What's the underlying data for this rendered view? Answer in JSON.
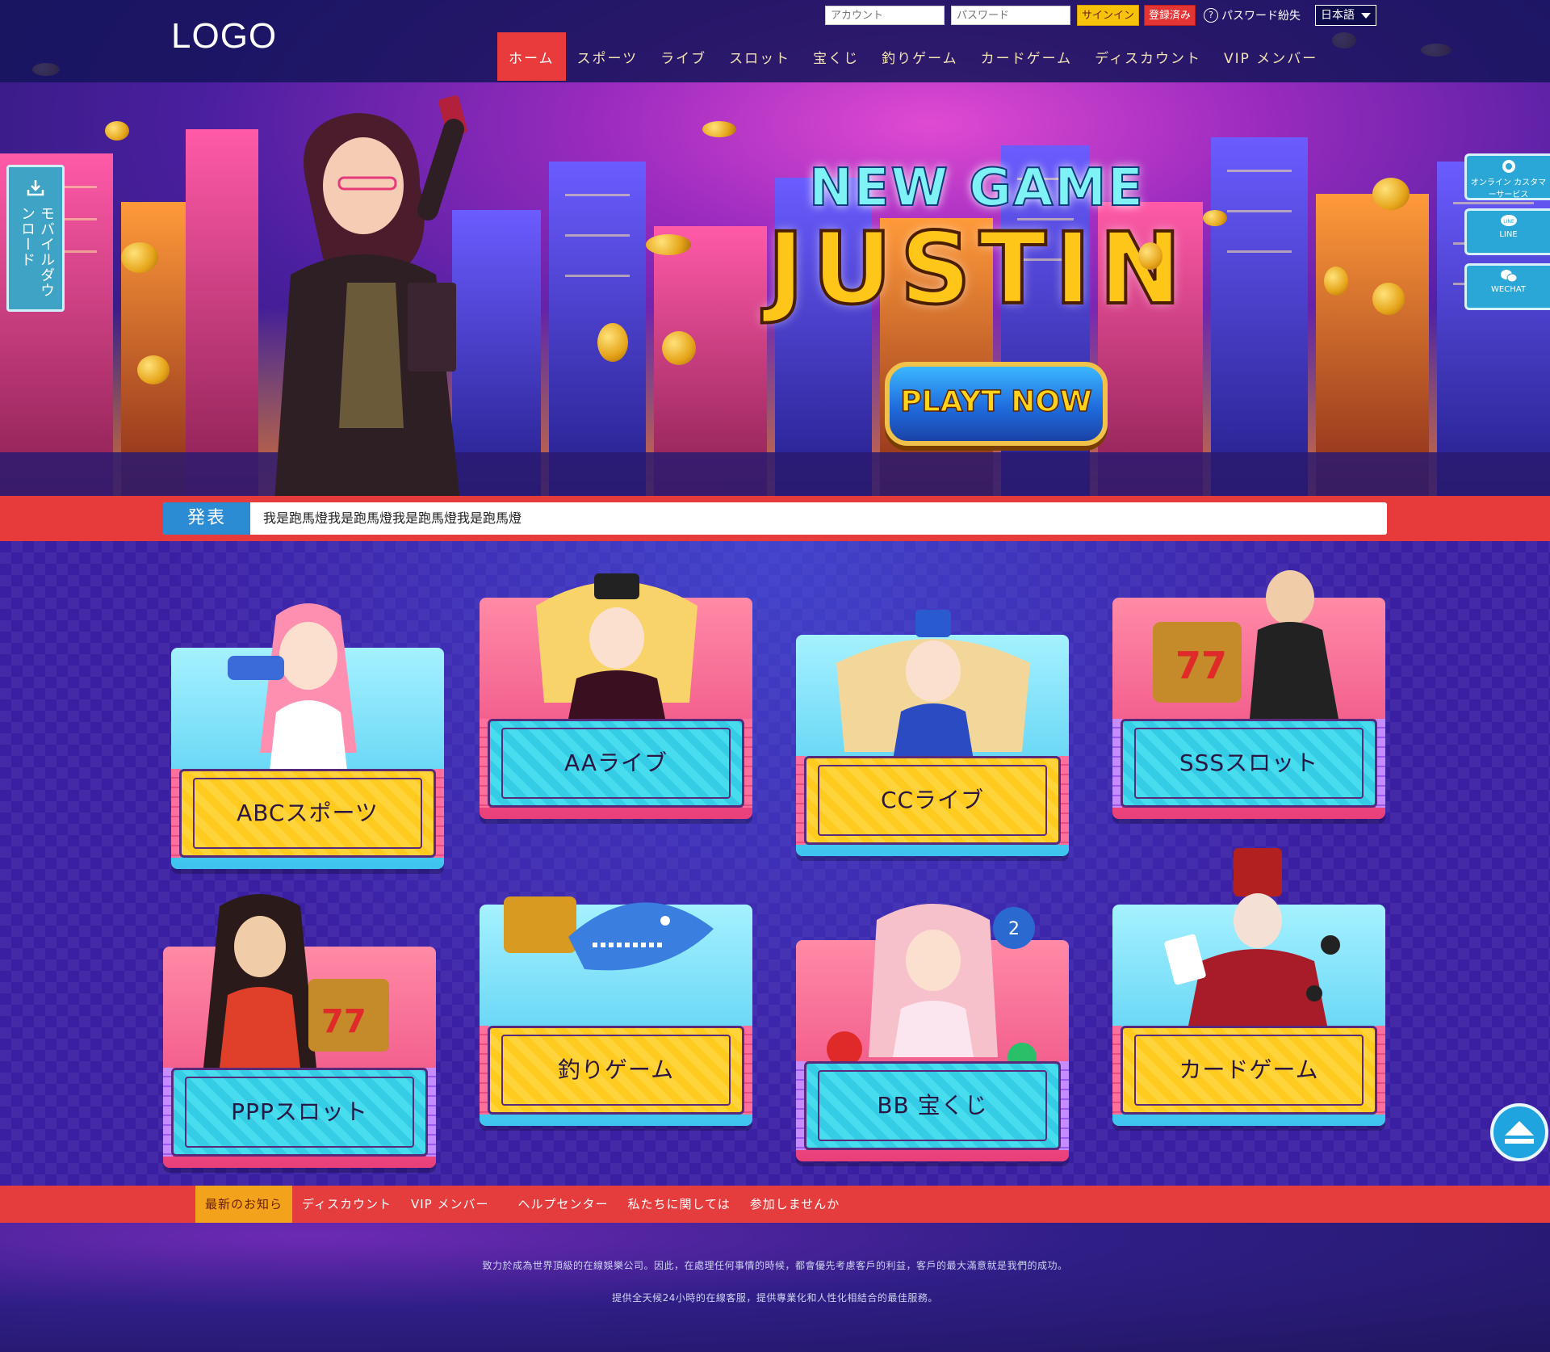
{
  "header": {
    "logo": "LOGO",
    "account_placeholder": "アカウント",
    "password_placeholder": "パスワード",
    "signin_label": "サインイン",
    "register_label": "登録済み",
    "forgot_label": "パスワード紛失",
    "language": "日本語"
  },
  "nav": {
    "items": [
      "ホーム",
      "スポーツ",
      "ライブ",
      "スロット",
      "宝くじ",
      "釣りゲーム",
      "カードゲーム",
      "ディスカウント",
      "VIP メンバー"
    ],
    "active": "ホーム"
  },
  "hero": {
    "headline": "NEW GAME",
    "title": "JUSTIN",
    "button": "PLAYT NOW"
  },
  "side_left": {
    "label": "モバイルダウンロード",
    "icon": "download-icon"
  },
  "side_right": [
    {
      "label": "オンライン カスタマーサービス",
      "icon": "headset-icon"
    },
    {
      "label": "LINE",
      "icon": "line-icon"
    },
    {
      "label": "WECHAT",
      "icon": "wechat-icon"
    }
  ],
  "marquee": {
    "tag": "発表",
    "text": "我是跑馬燈我是跑馬燈我是跑馬燈我是跑馬燈"
  },
  "games": [
    {
      "label": "ABCスポーツ",
      "panel": "cyan",
      "plate": "yellow"
    },
    {
      "label": "AAライブ",
      "panel": "pink",
      "plate": "blue"
    },
    {
      "label": "CCライブ",
      "panel": "cyan",
      "plate": "yellow"
    },
    {
      "label": "SSSスロット",
      "panel": "pink",
      "plate": "blue"
    },
    {
      "label": "PPPスロット",
      "panel": "pink",
      "plate": "blue"
    },
    {
      "label": "釣りゲーム",
      "panel": "cyan",
      "plate": "yellow"
    },
    {
      "label": "BB 宝くじ",
      "panel": "pink",
      "plate": "blue"
    },
    {
      "label": "カードゲーム",
      "panel": "cyan",
      "plate": "yellow"
    }
  ],
  "footer": {
    "nav": [
      "最新のお知ら",
      "ディスカウント",
      "VIP メンバー",
      "ヘルプセンター",
      "私たちに関しては",
      "参加しませんか"
    ],
    "active": "最新のお知ら",
    "line1": "致力於成為世界頂級的在線娛樂公司。因此，在處理任何事情的時候，都會優先考慮客戶的利益，客戶的最大滿意就是我們的成功。",
    "line2": "提供全天候24小時的在線客服，提供專業化和人性化相結合的最佳服務。"
  },
  "colors": {
    "nav_active": "#e93b3b",
    "band_red": "#e73a3a",
    "accent_blue": "#2b8cd4",
    "accent_yellow": "#f6c20a"
  }
}
